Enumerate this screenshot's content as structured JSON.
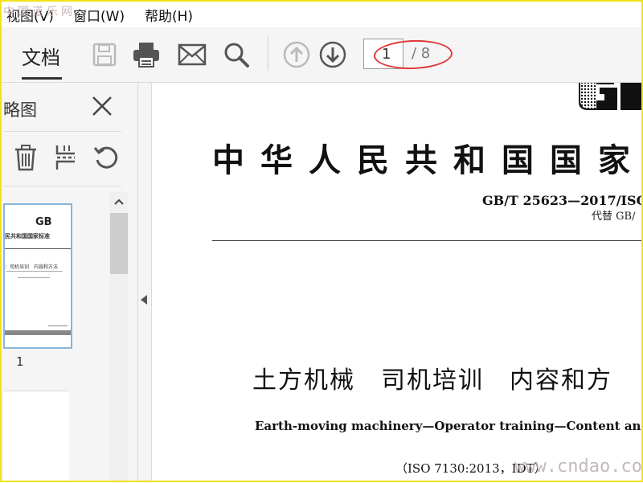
{
  "menu": {
    "items": [
      "视图(V)",
      "窗口(W)",
      "帮助(H)"
    ],
    "watermark_top": "中国道乐网"
  },
  "toolbar": {
    "tab_label": "文档",
    "icons": [
      "save-icon",
      "print-icon",
      "mail-icon",
      "search-icon",
      "arrow-up-icon",
      "arrow-down-icon"
    ],
    "page_current": "1",
    "page_total": "/ 8"
  },
  "sidebar": {
    "title": "略图",
    "tools": [
      "trash-icon",
      "extract-icon",
      "rotate-icon"
    ],
    "thumbnail": {
      "page_number": "1",
      "logo": "GB",
      "title": "民共和国国家标准",
      "subtitle": "：司机培训　内容和方法"
    }
  },
  "document": {
    "title": "中华人民共和国国家",
    "standard_no": "GB/T 25623—2017/ISO",
    "replaces": "代替 GB/",
    "title_cn": "土方机械　司机培训　内容和方",
    "title_en": "Earth-moving machinery—Operator training—Content and m",
    "iso_ref": "（ISO 7130:2013，IDT）",
    "logo": "GB"
  },
  "watermark_bottom": "www.cndao.com",
  "colors": {
    "frame": "#f2e318",
    "highlight_ellipse": "#e0383a",
    "thumb_border": "#8ab5da"
  }
}
